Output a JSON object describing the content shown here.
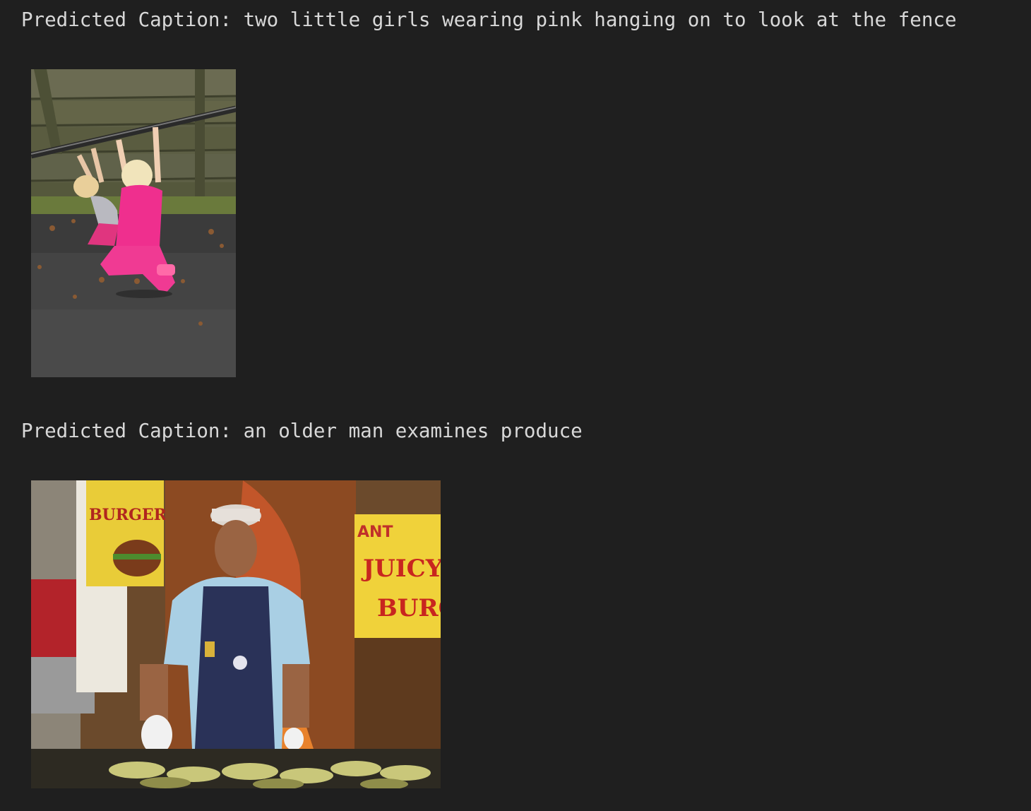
{
  "outputs": [
    {
      "caption": "Predicted Caption: two little girls wearing pink hanging on to look at the fence",
      "image_subject": "two-girls-monkey-bars-photo"
    },
    {
      "caption": "Predicted Caption: an older man examines produce",
      "image_subject": "food-vendor-grilling-corn-photo",
      "sign_text": [
        "BURGERS",
        "ANT",
        "JUICY",
        "BURG"
      ]
    }
  ],
  "colors": {
    "background": "#1f1f1f",
    "text": "#d8d8d8"
  }
}
